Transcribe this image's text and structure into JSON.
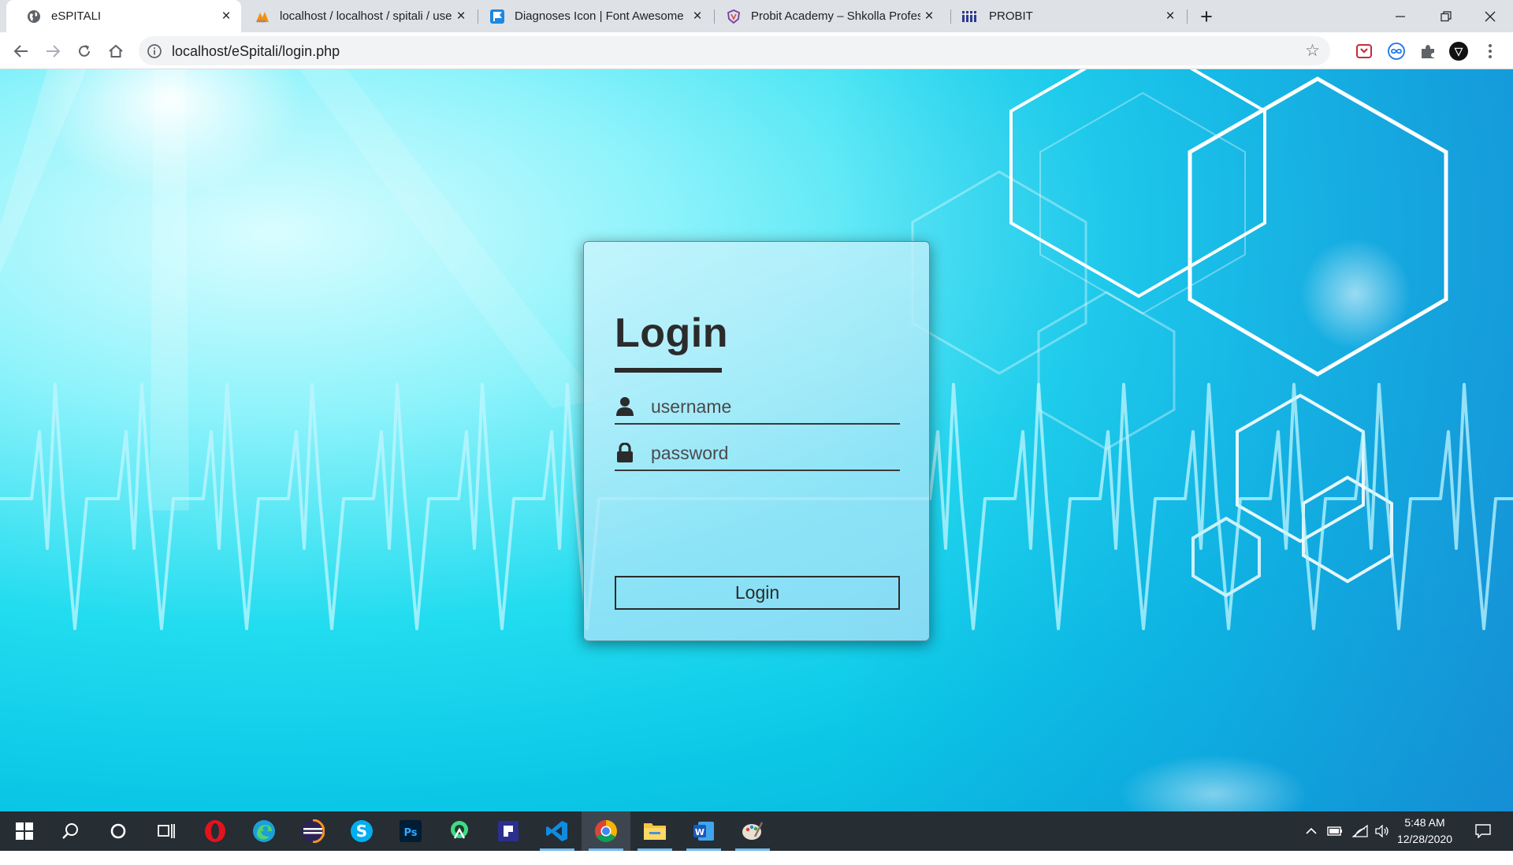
{
  "browser": {
    "tabs": [
      {
        "title": "eSPITALI",
        "favicon": "globe-icon",
        "active": true
      },
      {
        "title": "localhost / localhost / spitali / users",
        "favicon": "phpmyadmin-icon",
        "active": false
      },
      {
        "title": "Diagnoses Icon | Font Awesome",
        "favicon": "font-awesome-icon",
        "active": false
      },
      {
        "title": "Probit Academy – Shkolla Profesionale",
        "favicon": "probit-academy-icon",
        "active": false
      },
      {
        "title": "PROBIT",
        "favicon": "probit-icon",
        "active": false
      }
    ],
    "new_tab": "+",
    "window_controls": {
      "minimize": "—",
      "restore": "❐",
      "close": "✕"
    },
    "url": "localhost/eSpitali/login.php",
    "extensions": [
      "pocket-icon",
      "infinity-extension-icon",
      "puzzle-extensions-icon",
      "profile-avatar-icon",
      "menu-dots-icon"
    ]
  },
  "login": {
    "title": "Login",
    "username_placeholder": "username",
    "password_placeholder": "password",
    "submit_label": "Login",
    "icons": {
      "username": "user-icon",
      "password": "lock-icon"
    }
  },
  "taskbar": {
    "apps": [
      "windows-start-icon",
      "search-icon",
      "cortana-icon",
      "task-view-icon",
      "opera-icon",
      "edge-icon",
      "eclipse-icon",
      "skype-icon",
      "photoshop-icon",
      "android-studio-icon",
      "app-icon",
      "vscode-icon",
      "chrome-icon",
      "file-explorer-icon",
      "word-icon",
      "paint-icon"
    ],
    "time": "5:48 AM",
    "date": "12/28/2020"
  },
  "colors": {
    "page_bg_light": "#d9fdff",
    "page_bg_mid": "#22dcef",
    "page_bg_deep": "#0aa9d8",
    "card_text": "#2b2b2b",
    "taskbar": "#262d33",
    "tab_bar": "#dee1e6"
  }
}
